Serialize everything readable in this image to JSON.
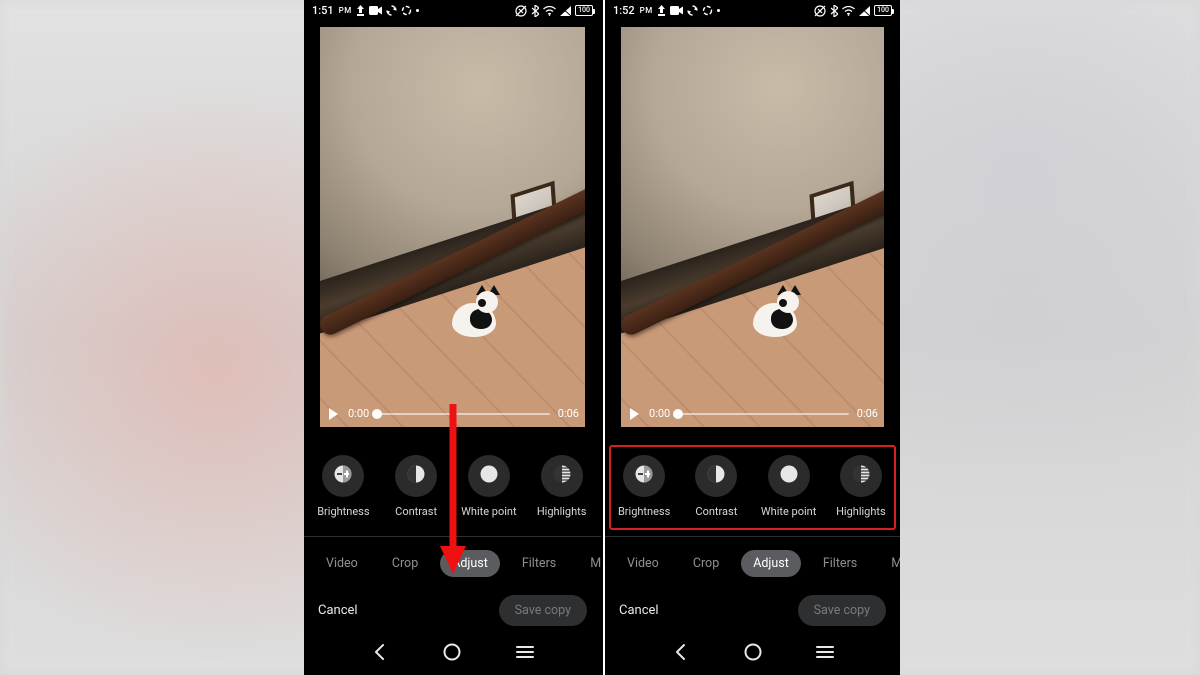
{
  "left": {
    "status": {
      "time": "1:51",
      "ampm": "PM",
      "battery": "100"
    },
    "video": {
      "current": "0:00",
      "duration": "0:06"
    },
    "adjust": [
      {
        "name": "brightness",
        "label": "Brightness"
      },
      {
        "name": "contrast",
        "label": "Contrast"
      },
      {
        "name": "whitepoint",
        "label": "White point"
      },
      {
        "name": "highlights",
        "label": "Highlights"
      }
    ],
    "tabs": [
      "Video",
      "Crop",
      "Adjust",
      "Filters",
      "Markup"
    ],
    "active_tab": "Adjust",
    "actions": {
      "cancel": "Cancel",
      "save": "Save copy"
    }
  },
  "right": {
    "status": {
      "time": "1:52",
      "ampm": "PM",
      "battery": "100"
    },
    "video": {
      "current": "0:00",
      "duration": "0:06"
    },
    "adjust": [
      {
        "name": "brightness",
        "label": "Brightness"
      },
      {
        "name": "contrast",
        "label": "Contrast"
      },
      {
        "name": "whitepoint",
        "label": "White point"
      },
      {
        "name": "highlights",
        "label": "Highlights"
      }
    ],
    "tabs": [
      "Video",
      "Crop",
      "Adjust",
      "Filters",
      "Markup"
    ],
    "active_tab": "Adjust",
    "actions": {
      "cancel": "Cancel",
      "save": "Save copy"
    }
  }
}
